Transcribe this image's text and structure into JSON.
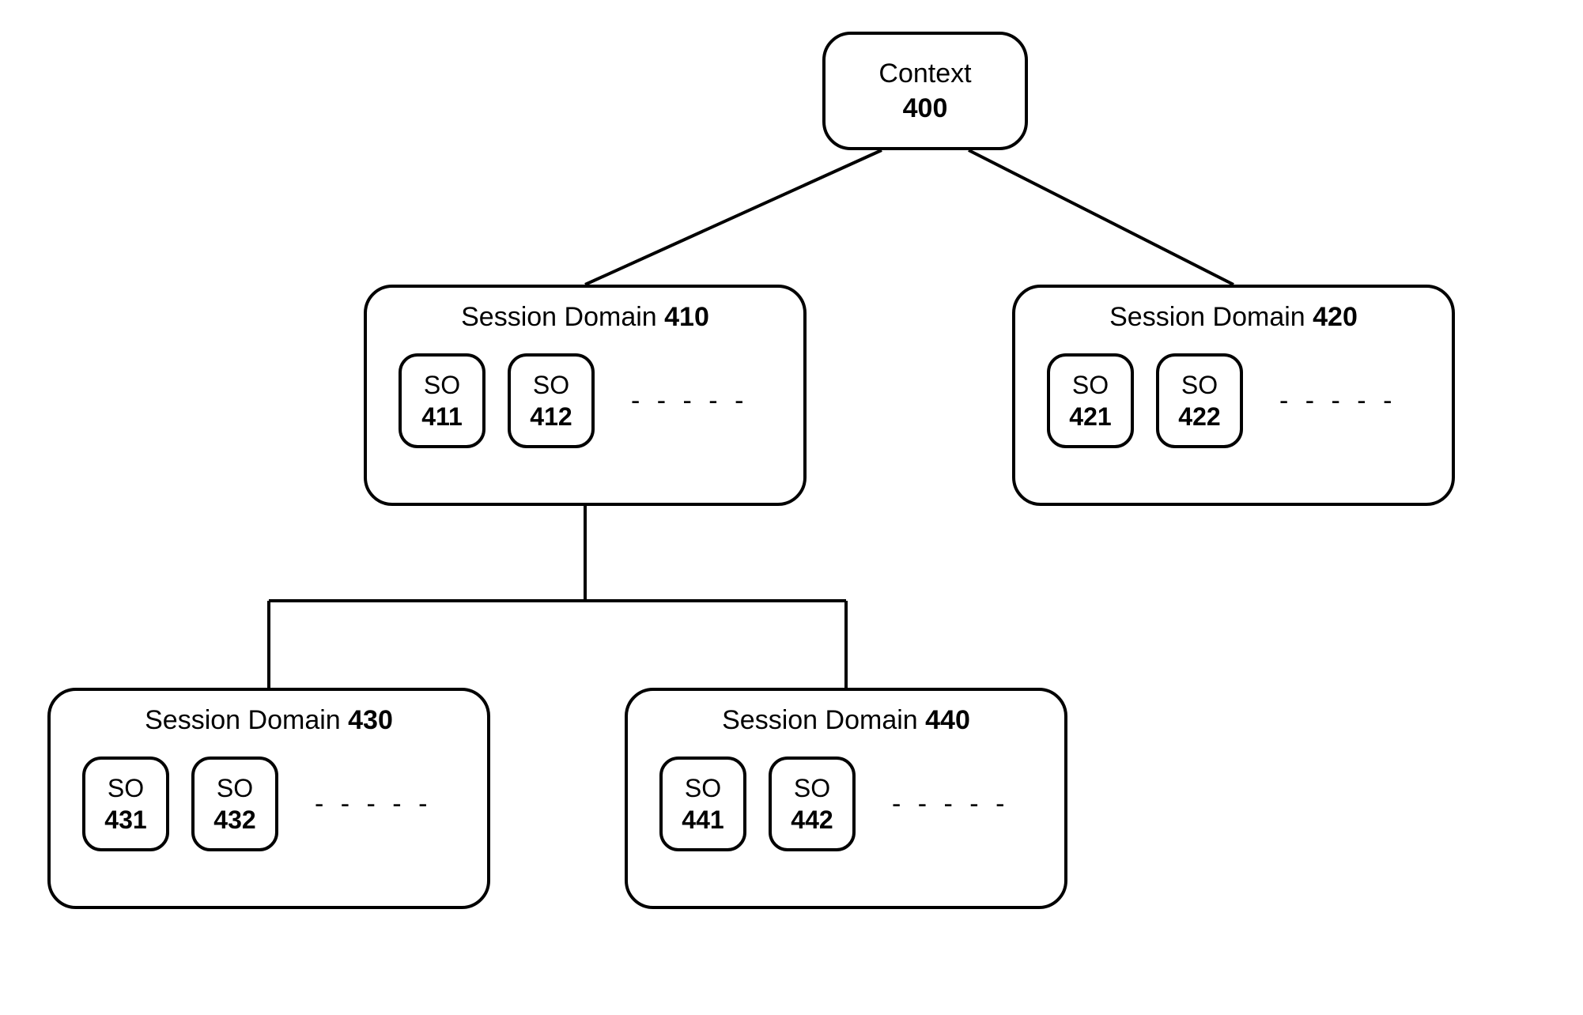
{
  "context": {
    "label": "Context",
    "num": "400"
  },
  "domains": {
    "d410": {
      "title": "Session Domain",
      "num": "410",
      "so": [
        {
          "label": "SO",
          "num": "411"
        },
        {
          "label": "SO",
          "num": "412"
        }
      ],
      "ellipsis": "- - - - -"
    },
    "d420": {
      "title": "Session Domain",
      "num": "420",
      "so": [
        {
          "label": "SO",
          "num": "421"
        },
        {
          "label": "SO",
          "num": "422"
        }
      ],
      "ellipsis": "- - - - -"
    },
    "d430": {
      "title": "Session Domain",
      "num": "430",
      "so": [
        {
          "label": "SO",
          "num": "431"
        },
        {
          "label": "SO",
          "num": "432"
        }
      ],
      "ellipsis": "- - - - -"
    },
    "d440": {
      "title": "Session Domain",
      "num": "440",
      "so": [
        {
          "label": "SO",
          "num": "441"
        },
        {
          "label": "SO",
          "num": "442"
        }
      ],
      "ellipsis": "- - - - -"
    }
  }
}
